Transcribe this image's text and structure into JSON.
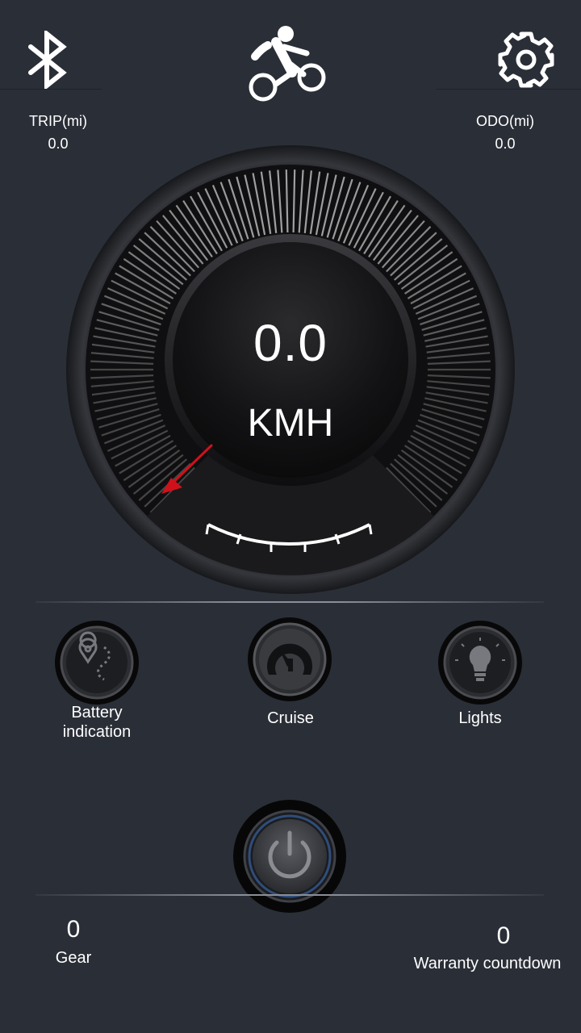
{
  "header": {
    "bluetooth_icon": "bluetooth-icon",
    "rider_icon": "cyclist-icon",
    "settings_icon": "gear-icon"
  },
  "stats": {
    "trip": {
      "label": "TRIP(mi)",
      "value": "0.0"
    },
    "odo": {
      "label": "ODO(mi)",
      "value": "0.0"
    }
  },
  "speedometer": {
    "speed": "0.0",
    "unit": "KMH",
    "needle_color": "#d0111b",
    "needle_level": 0
  },
  "controls": [
    {
      "label_line1": "Battery",
      "label_line2": "indication",
      "icon": "map-route-icon"
    },
    {
      "label": "Cruise",
      "icon": "speedometer-icon"
    },
    {
      "label": "Lights",
      "icon": "lightbulb-icon"
    }
  ],
  "power": {
    "icon": "power-icon"
  },
  "footer": {
    "gear": {
      "value": "0",
      "label": "Gear"
    },
    "warranty": {
      "value": "0",
      "label": "Warranty countdown"
    }
  },
  "colors": {
    "background": "#2a2e37",
    "accent_red": "#d0111b",
    "text": "#ffffff"
  }
}
